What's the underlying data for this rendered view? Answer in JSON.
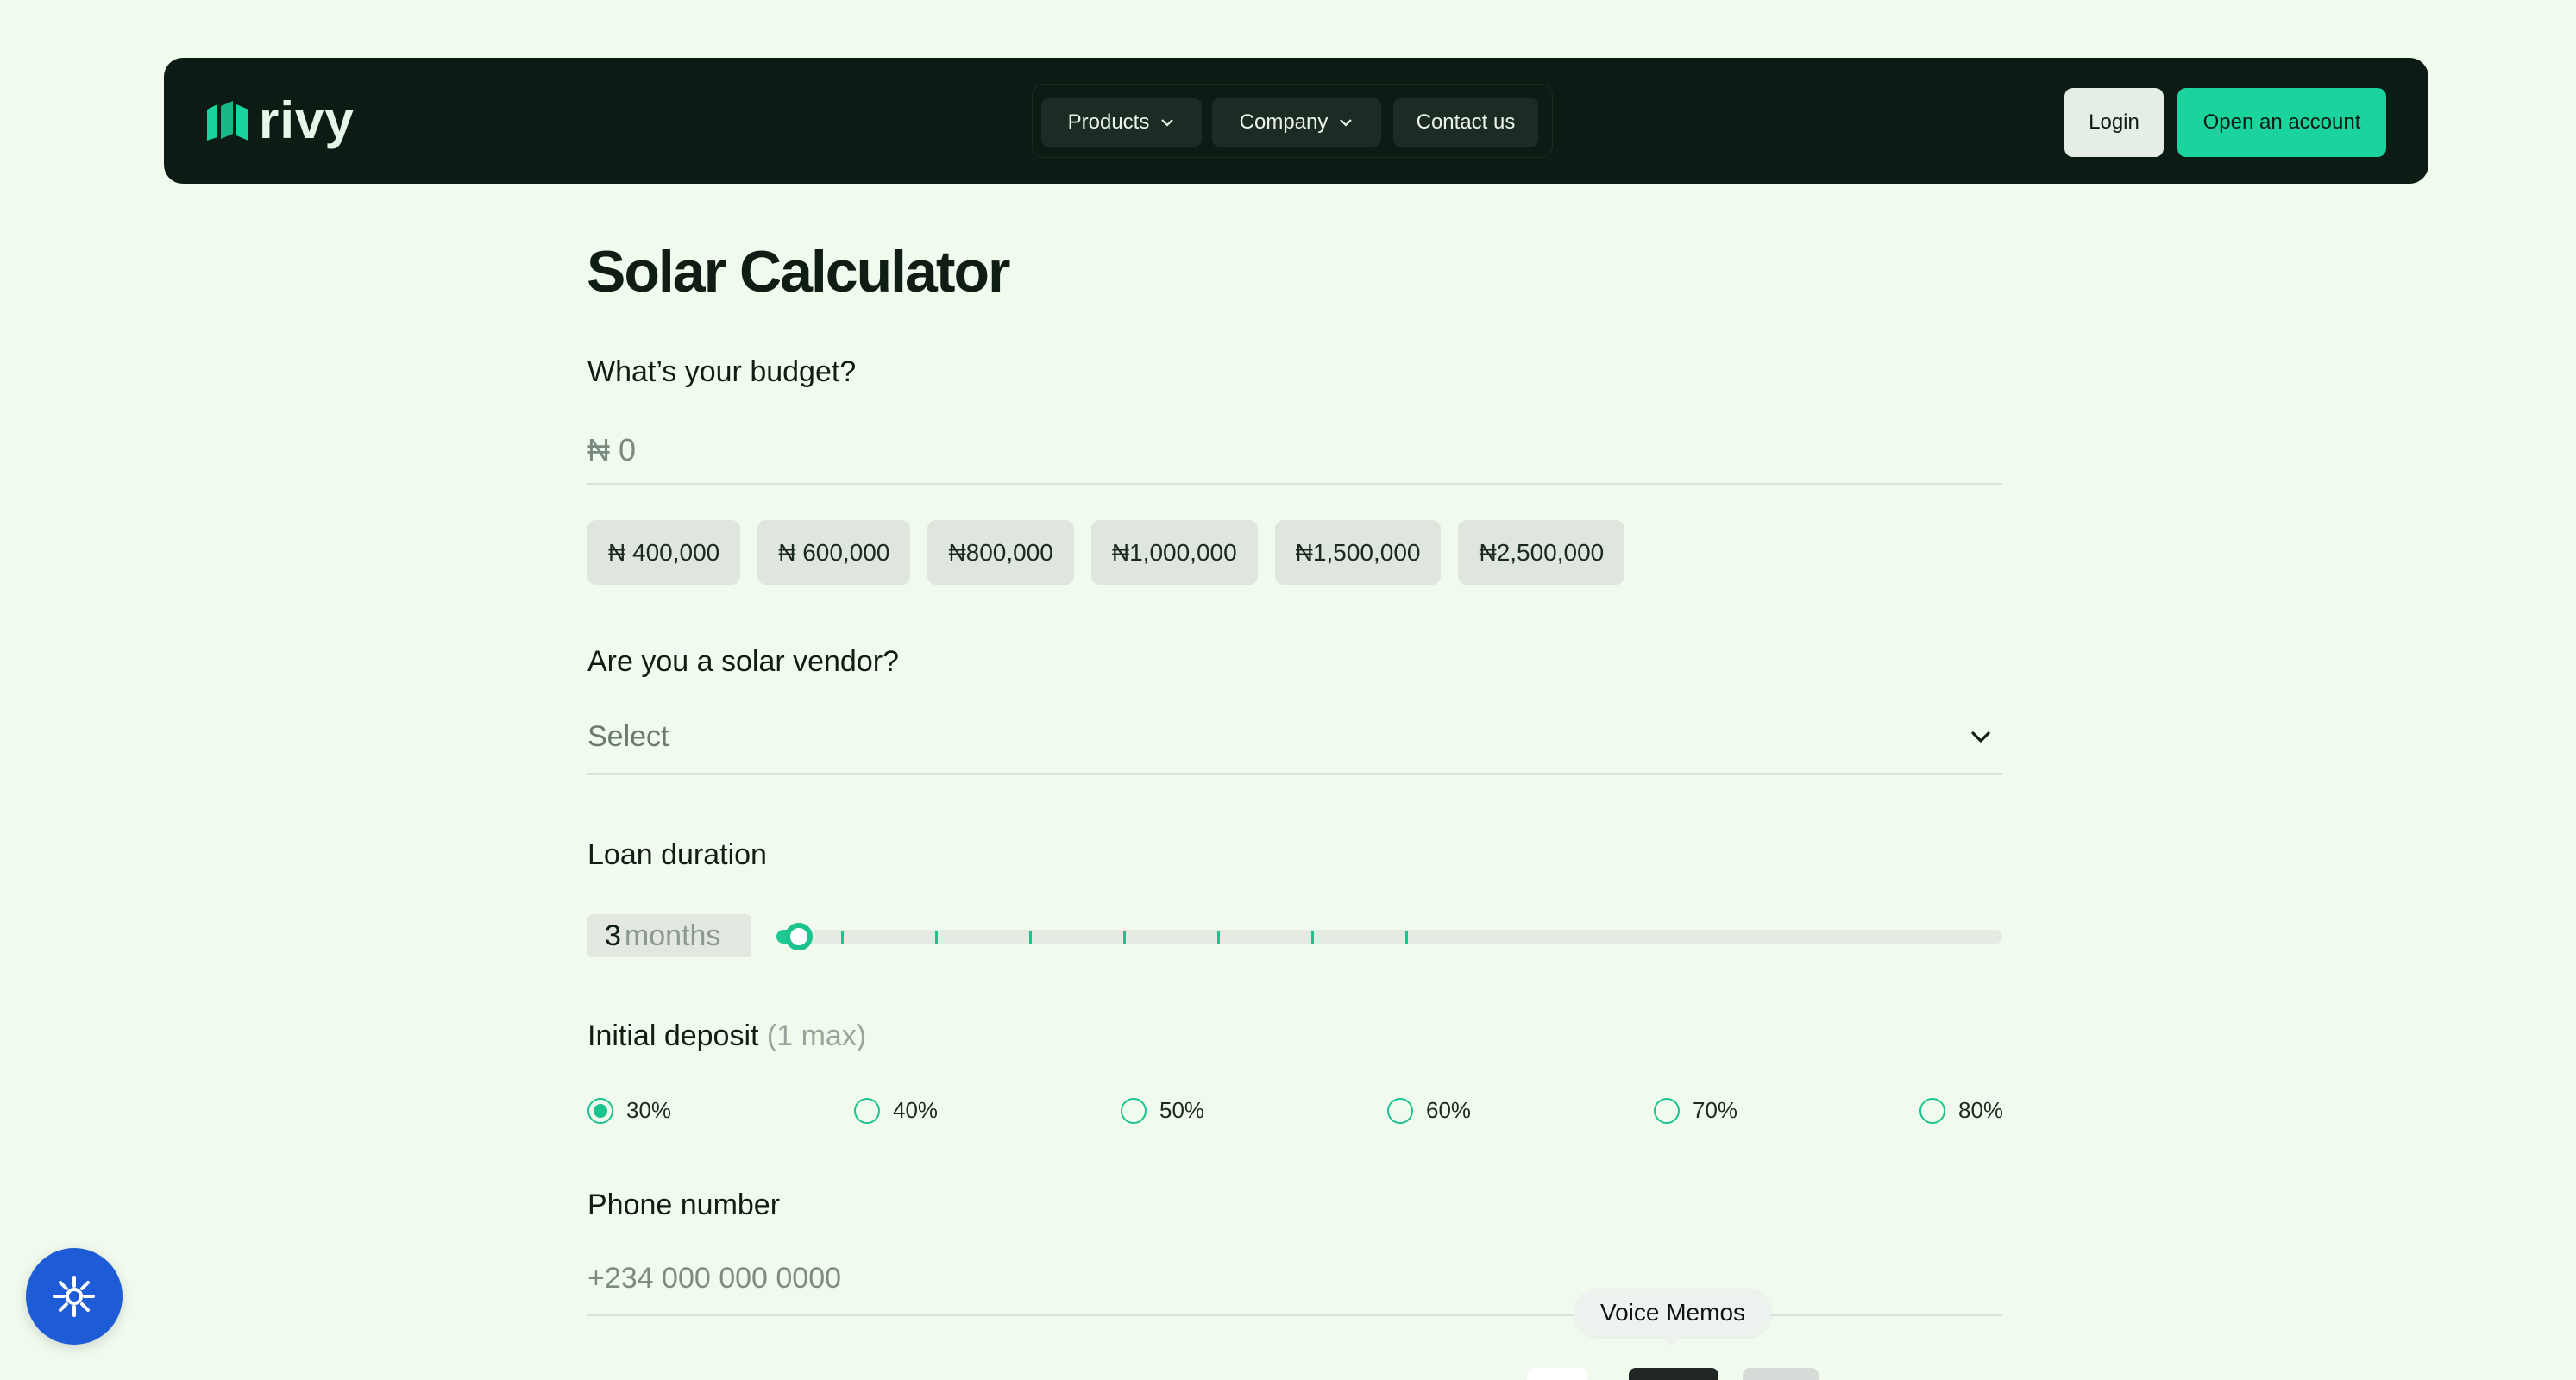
{
  "brand": {
    "name": "rivy",
    "accent": "#1bd39c",
    "nav_bg": "#0c1c14"
  },
  "nav": {
    "products": "Products",
    "company": "Company",
    "contact": "Contact us",
    "login": "Login",
    "open_account": "Open an account"
  },
  "page": {
    "title": "Solar Calculator"
  },
  "budget": {
    "label": "What’s your budget?",
    "placeholder": "₦ 0",
    "presets": [
      "₦ 400,000",
      "₦ 600,000",
      "₦800,000",
      "₦1,000,000",
      "₦1,500,000",
      "₦2,500,000"
    ]
  },
  "vendor": {
    "label": "Are you a solar vendor?",
    "value": "Select"
  },
  "duration": {
    "label": "Loan duration",
    "value": "3",
    "unit": "months",
    "ticks": 7
  },
  "deposit": {
    "label": "Initial deposit",
    "hint": "(1 max)",
    "options": [
      "30%",
      "40%",
      "50%",
      "60%",
      "70%",
      "80%"
    ],
    "selected": "30%"
  },
  "phone": {
    "label": "Phone number",
    "placeholder": "+234 000 000 0000"
  },
  "overlays": {
    "tooltip": "Voice Memos",
    "fab_icon": "sun-gear-icon"
  }
}
